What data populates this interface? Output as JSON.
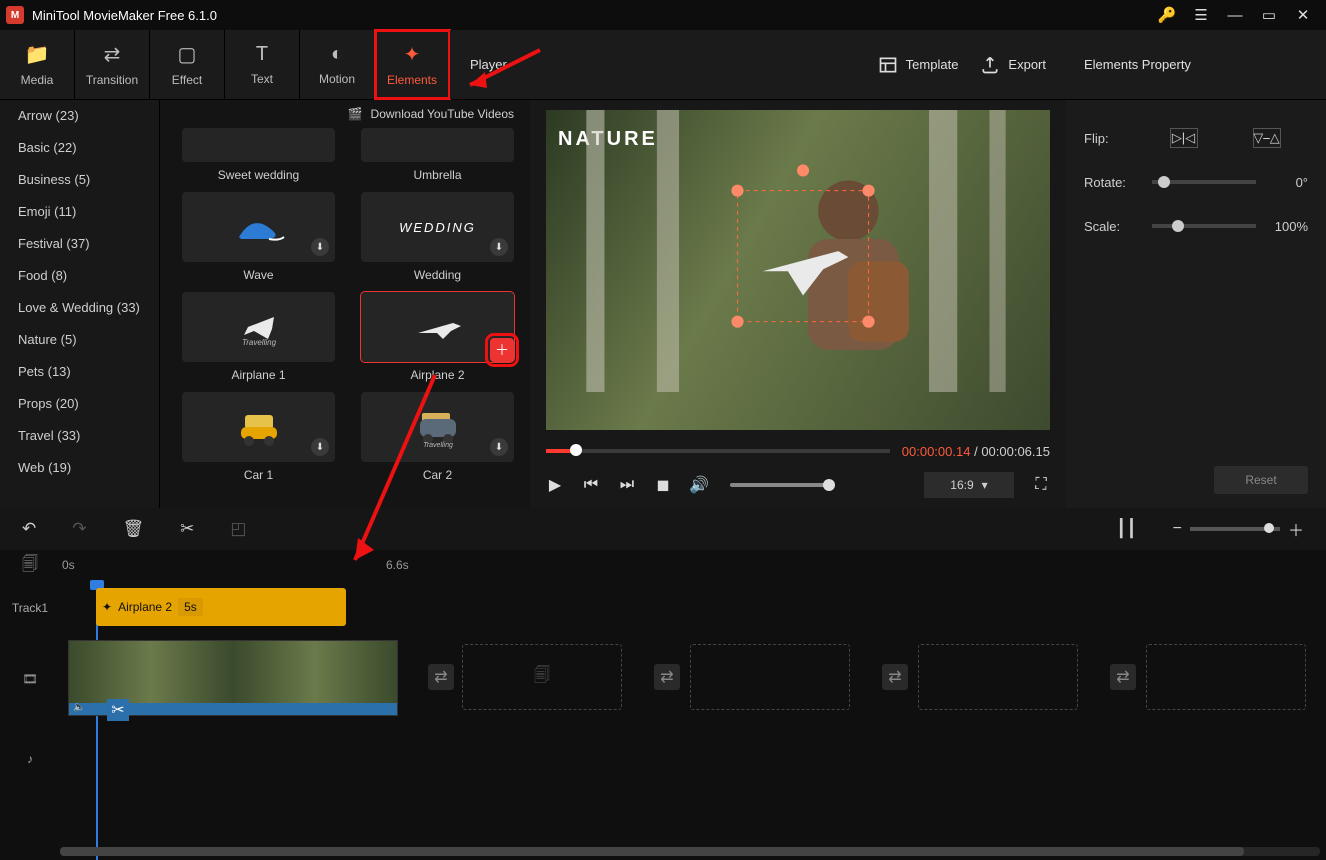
{
  "app": {
    "title": "MiniTool MovieMaker Free 6.1.0"
  },
  "tabs": [
    {
      "label": "Media",
      "icon": "folder"
    },
    {
      "label": "Transition",
      "icon": "swap"
    },
    {
      "label": "Effect",
      "icon": "square"
    },
    {
      "label": "Text",
      "icon": "text"
    },
    {
      "label": "Motion",
      "icon": "circle"
    },
    {
      "label": "Elements",
      "icon": "sparkle",
      "active": true
    }
  ],
  "library": {
    "download_label": "Download YouTube Videos",
    "items": [
      {
        "label": "Sweet wedding",
        "small": true
      },
      {
        "label": "Umbrella",
        "small": true
      },
      {
        "label": "Wave",
        "dl": true,
        "thumb": "wave"
      },
      {
        "label": "Wedding",
        "dl": true,
        "thumb": "wedding"
      },
      {
        "label": "Airplane 1",
        "thumb": "plane1"
      },
      {
        "label": "Airplane 2",
        "thumb": "plane2",
        "selected": true,
        "add": true
      },
      {
        "label": "Car 1",
        "dl": true,
        "thumb": "car1"
      },
      {
        "label": "Car 2",
        "dl": true,
        "thumb": "car2"
      }
    ]
  },
  "categories": [
    {
      "label": "Arrow (23)"
    },
    {
      "label": "Basic (22)"
    },
    {
      "label": "Business (5)"
    },
    {
      "label": "Emoji (11)"
    },
    {
      "label": "Festival (37)"
    },
    {
      "label": "Food (8)"
    },
    {
      "label": "Love & Wedding (33)"
    },
    {
      "label": "Nature (5)"
    },
    {
      "label": "Pets (13)"
    },
    {
      "label": "Props (20)"
    },
    {
      "label": "Travel (33)"
    },
    {
      "label": "Web (19)"
    }
  ],
  "player": {
    "header": "Player",
    "template": "Template",
    "export": "Export",
    "overlay_text": "NATURE",
    "current_time": "00:00:00.14",
    "total_time": "00:00:06.15",
    "aspect": "16:9"
  },
  "properties": {
    "header": "Elements Property",
    "flip": "Flip:",
    "rotate": "Rotate:",
    "rotate_val": "0°",
    "scale": "Scale:",
    "scale_val": "100%",
    "reset": "Reset"
  },
  "timeline": {
    "track1": "Track1",
    "rule0": "0s",
    "rule1": "6.6s",
    "clip_name": "Airplane 2",
    "clip_dur": "5s"
  }
}
